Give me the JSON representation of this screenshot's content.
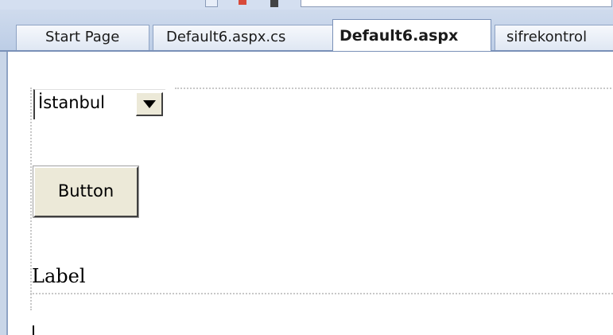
{
  "tabs": [
    {
      "label": "Start Page",
      "active": false
    },
    {
      "label": "Default6.aspx.cs",
      "active": false
    },
    {
      "label": "Default6.aspx",
      "active": true
    },
    {
      "label": "sifrekontrol",
      "active": false
    }
  ],
  "designer": {
    "dropdown": {
      "selected": "İstanbul",
      "arrow_icon": "triangle-down-icon"
    },
    "button_label": "Button",
    "label_text": "Label"
  },
  "colors": {
    "tab_strip": "#bccde6",
    "tab_border": "#7a91b8",
    "control_face": "#ece9d8"
  }
}
